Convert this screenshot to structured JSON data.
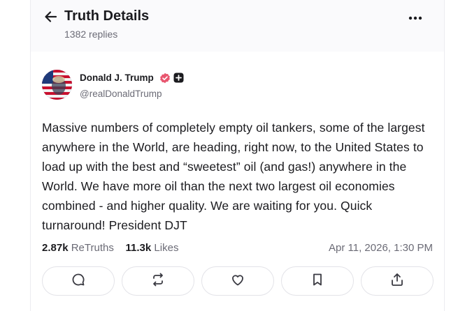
{
  "header": {
    "title": "Truth Details",
    "replies": "1382 replies"
  },
  "post": {
    "author_name": "Donald J. Trump",
    "author_handle": "@realDonaldTrump",
    "body": "Massive numbers of completely empty oil tankers, some of the largest anywhere in the World, are heading, right now, to the United States to load up with the best and “sweetest” oil (and gas!) anywhere in the World. We have more oil than the next two largest oil economies combined - and higher quality. We are waiting for you. Quick turnaround! President DJT",
    "retruths_count": "2.87k",
    "retruths_label": "ReTruths",
    "likes_count": "11.3k",
    "likes_label": "Likes",
    "timestamp": "Apr 11, 2026, 1:30 PM"
  },
  "colors": {
    "verified_badge": "#e8566f",
    "text_primary": "#1b1b1f",
    "text_secondary": "#6b6b76"
  },
  "icons": {
    "back": "arrow-left-icon",
    "more": "more-dots-icon",
    "verified": "verified-badge-icon",
    "plus": "plus-badge-icon",
    "reply": "reply-icon",
    "retruth": "retruth-icon",
    "like": "heart-icon",
    "bookmark": "bookmark-icon",
    "share": "share-icon"
  }
}
